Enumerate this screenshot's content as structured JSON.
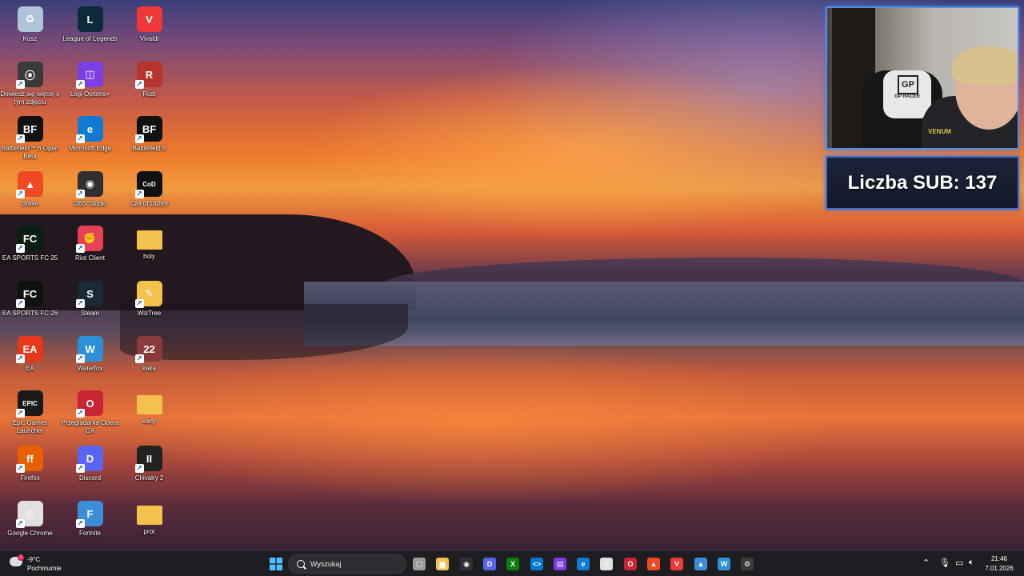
{
  "desktop_icons": [
    {
      "label": "Kosz",
      "color": "#b0c4d8",
      "glyph": "♻"
    },
    {
      "label": "League of Legends",
      "color": "#0c2a3a",
      "glyph": "L"
    },
    {
      "label": "Vivaldi",
      "color": "#ef3939",
      "glyph": "V"
    },
    {
      "label": "Dowiedz się więcej o tym zdjęciu",
      "color": "#3a3a3a",
      "glyph": "⦿"
    },
    {
      "label": "Logi Options+",
      "color": "#7b3fe4",
      "glyph": "◫"
    },
    {
      "label": "Rust",
      "color": "#b5342c",
      "glyph": "R"
    },
    {
      "label": "Battlefield™ 6 Open Beta",
      "color": "#111111",
      "glyph": "BF"
    },
    {
      "label": "Microsoft Edge",
      "color": "#0f7bd5",
      "glyph": "e"
    },
    {
      "label": "Battlefield 6",
      "color": "#111111",
      "glyph": "BF"
    },
    {
      "label": "Brave",
      "color": "#f04a23",
      "glyph": "▲"
    },
    {
      "label": "OBS Studio",
      "color": "#302e31",
      "glyph": "◉"
    },
    {
      "label": "Call of Duty®",
      "color": "#111111",
      "glyph": "CoD"
    },
    {
      "label": "EA SPORTS FC 25",
      "color": "#0a1e12",
      "glyph": "FC"
    },
    {
      "label": "Riot Client",
      "color": "#e84057",
      "glyph": "✊"
    },
    {
      "label": "holy",
      "color": "#f3c24d",
      "glyph": ""
    },
    {
      "label": "EA SPORTS FC 26",
      "color": "#111111",
      "glyph": "FC"
    },
    {
      "label": "Steam",
      "color": "#1b2838",
      "glyph": "S"
    },
    {
      "label": "WizTree",
      "color": "#f3c24d",
      "glyph": "✎"
    },
    {
      "label": "EA",
      "color": "#e8381c",
      "glyph": "EA"
    },
    {
      "label": "Waterfox",
      "color": "#2c8fd8",
      "glyph": "W"
    },
    {
      "label": "kaka",
      "color": "#8a3a3a",
      "glyph": "22"
    },
    {
      "label": "Epic Games Launcher",
      "color": "#1a1a1a",
      "glyph": "EPIC"
    },
    {
      "label": "Przeglądarka Opera GX",
      "color": "#c82434",
      "glyph": "O"
    },
    {
      "label": "karty",
      "color": "#f3c24d",
      "glyph": ""
    },
    {
      "label": "Firefox",
      "color": "#e66000",
      "glyph": "ff"
    },
    {
      "label": "Discord",
      "color": "#5865f2",
      "glyph": "D"
    },
    {
      "label": "Chivalry 2",
      "color": "#222222",
      "glyph": "II"
    },
    {
      "label": "Google Chrome",
      "color": "#e0e0e0",
      "glyph": "◎"
    },
    {
      "label": "Fortnite",
      "color": "#3d8ed8",
      "glyph": "F"
    },
    {
      "label": "prot",
      "color": "#f3c24d",
      "glyph": ""
    }
  ],
  "overlay": {
    "sub_counter": "Liczba SUB: 137",
    "cam_logo": "GP",
    "cam_logo_text": "GP RACER",
    "cam_shirt": "VENUM"
  },
  "taskbar": {
    "weather_temp": "-9°C",
    "weather_condition": "Pochmurnie",
    "weather_badge": "1",
    "search_placeholder": "Wyszukaj",
    "pinned": [
      {
        "name": "task-view",
        "color": "#9a9a9a",
        "glyph": "▢"
      },
      {
        "name": "file-explorer",
        "color": "#f3c24d",
        "glyph": "▆"
      },
      {
        "name": "obs",
        "color": "#302e31",
        "glyph": "◉"
      },
      {
        "name": "discord",
        "color": "#5865f2",
        "glyph": "D"
      },
      {
        "name": "xbox",
        "color": "#107c10",
        "glyph": "X"
      },
      {
        "name": "vscode",
        "color": "#0078d4",
        "glyph": "<>"
      },
      {
        "name": "app-purple",
        "color": "#7b3fe4",
        "glyph": "▤"
      },
      {
        "name": "edge",
        "color": "#0f7bd5",
        "glyph": "e"
      },
      {
        "name": "chrome",
        "color": "#e0e0e0",
        "glyph": "◎"
      },
      {
        "name": "opera-gx",
        "color": "#c82434",
        "glyph": "O"
      },
      {
        "name": "brave",
        "color": "#f04a23",
        "glyph": "▲"
      },
      {
        "name": "vivaldi",
        "color": "#ef3939",
        "glyph": "V"
      },
      {
        "name": "photos",
        "color": "#3d8ed8",
        "glyph": "▲"
      },
      {
        "name": "waterfox",
        "color": "#2c8fd8",
        "glyph": "W"
      },
      {
        "name": "app-settings",
        "color": "#3a3a3a",
        "glyph": "⚙"
      }
    ],
    "clock_time": "21:46",
    "clock_date": "7.01.2026"
  }
}
